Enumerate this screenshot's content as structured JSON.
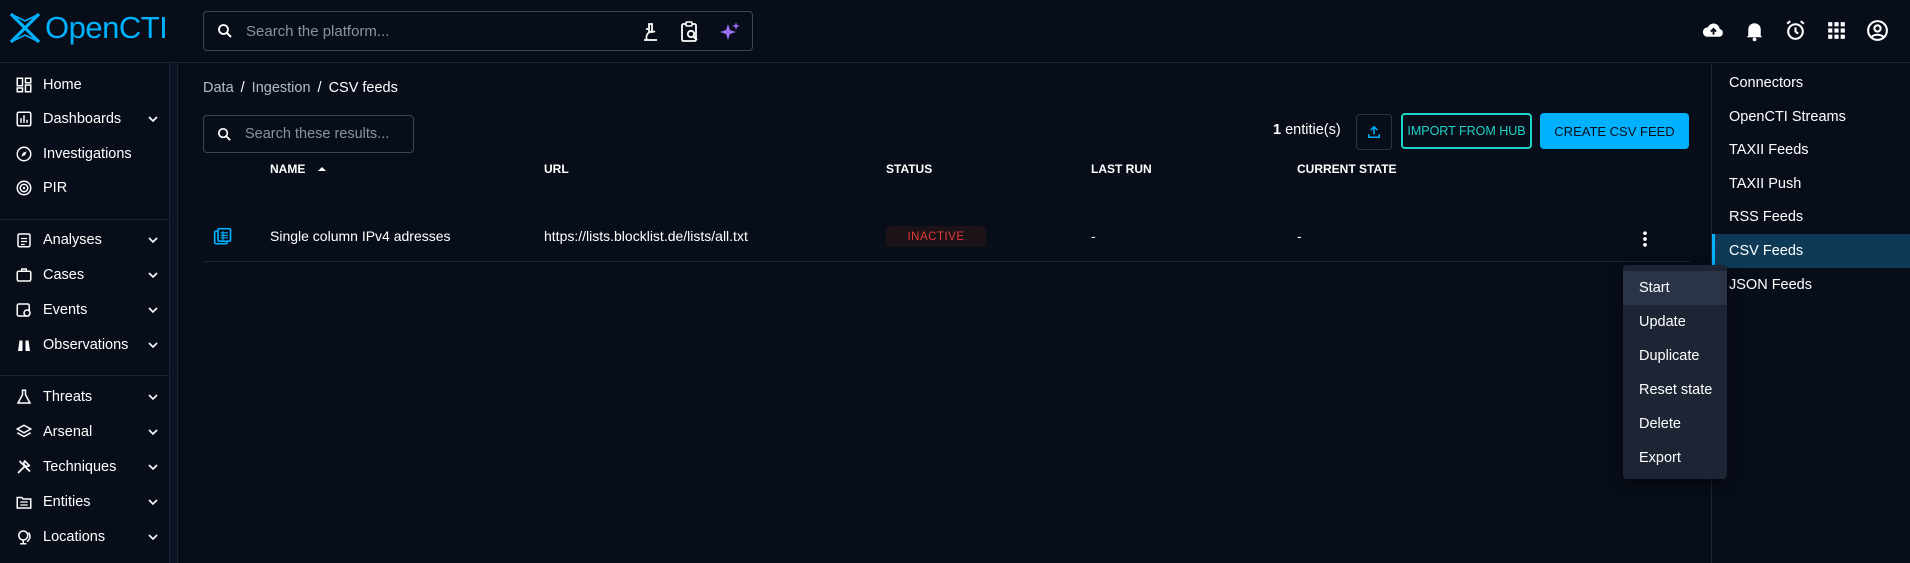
{
  "app": {
    "name": "OpenCTI"
  },
  "search": {
    "placeholder": "Search the platform..."
  },
  "left_nav": {
    "items": [
      {
        "label": "Home"
      },
      {
        "label": "Dashboards"
      },
      {
        "label": "Investigations"
      },
      {
        "label": "PIR"
      },
      {
        "label": "Analyses"
      },
      {
        "label": "Cases"
      },
      {
        "label": "Events"
      },
      {
        "label": "Observations"
      },
      {
        "label": "Threats"
      },
      {
        "label": "Arsenal"
      },
      {
        "label": "Techniques"
      },
      {
        "label": "Entities"
      },
      {
        "label": "Locations"
      }
    ]
  },
  "breadcrumb": {
    "items": [
      "Data",
      "Ingestion",
      "CSV feeds"
    ],
    "separator": "/"
  },
  "filter": {
    "placeholder": "Search these results..."
  },
  "toolbar": {
    "count": "1",
    "count_suffix": "entitie(s)",
    "import_label": "IMPORT FROM HUB",
    "create_label": "CREATE CSV FEED"
  },
  "table": {
    "headers": {
      "name": "NAME",
      "url": "URL",
      "status": "STATUS",
      "last_run": "LAST RUN",
      "current_state": "CURRENT STATE"
    },
    "rows": [
      {
        "name": "Single column IPv4 adresses",
        "url": "https://lists.blocklist.de/lists/all.txt",
        "status": "INACTIVE",
        "last_run": "-",
        "current_state": "-"
      }
    ]
  },
  "right_nav": {
    "items": [
      {
        "label": "Connectors"
      },
      {
        "label": "OpenCTI Streams"
      },
      {
        "label": "TAXII Feeds"
      },
      {
        "label": "TAXII Push"
      },
      {
        "label": "RSS Feeds"
      },
      {
        "label": "CSV Feeds"
      },
      {
        "label": "JSON Feeds"
      }
    ],
    "active": "CSV Feeds"
  },
  "context_menu": {
    "items": [
      {
        "label": "Start"
      },
      {
        "label": "Update"
      },
      {
        "label": "Duplicate"
      },
      {
        "label": "Reset state"
      },
      {
        "label": "Delete"
      },
      {
        "label": "Export"
      }
    ]
  },
  "colors": {
    "accent": "#00b1ff",
    "teal": "#1ed3c8",
    "inactive": "#e53935",
    "background": "#070d19"
  }
}
